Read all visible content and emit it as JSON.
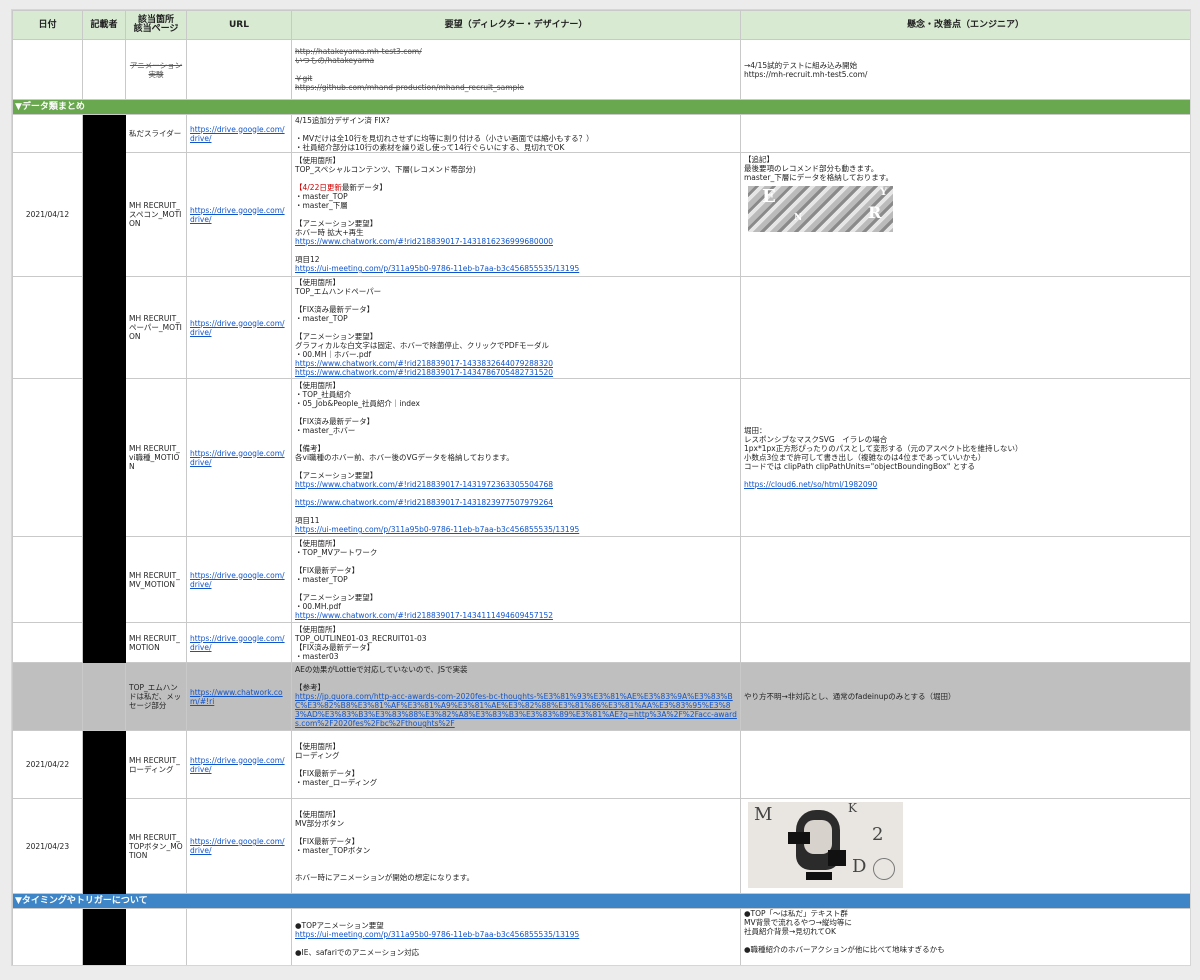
{
  "headers": {
    "date": "日付",
    "author": "記載者",
    "page": "該当箇所\n該当ページ",
    "url": "URL",
    "request": "要望（ディレクター・デザイナー）",
    "concerns": "懸念・改善点（エンジニア）"
  },
  "rows": [
    {
      "date": "",
      "page": "アニメーション実験",
      "url": "",
      "request": "http://hatakeyama.mh-test3.com/\nいつもの/hatakeyama\n\n￥git\nhttps://github.com/mhand-production/mhand_recruit_sample",
      "concerns": "→4/15試的テストに組み込み開始\nhttps://mh-recruit.mh-test5.com/"
    }
  ],
  "sections": {
    "data": "▼データ類まとめ",
    "timing": "▼タイミングやトリガーについて"
  },
  "data_rows": [
    {
      "date": "",
      "page": "私だスライダー",
      "url": "https://drive.google.com/drive/",
      "request": "4/15追加分デザイン済 FIX?\n\n・MVだけは全10行を見切れさせずに均等に割り付ける（小さい画面では縮小もする？）\n・社員紹介部分は10行の素材を繰り返し使って14行ぐらいにする、見切れでOK",
      "concerns": ""
    },
    {
      "date": "2021/04/12",
      "page": "MH RECRUIT_スペコン_MOTION",
      "url": "https://drive.google.com/drive/",
      "request_parts": {
        "l1": "【使用箇所】",
        "l2": "TOP_スペシャルコンテンツ、下層(レコメンド帯部分)",
        "red": "【4/22日更新",
        "l3": "最新データ】",
        "l4": "・master_TOP\n・master_下層\n\n【アニメーション要望】\nホバー時 拡大+再生",
        "link1": "https://www.chatwork.com/#!rid218839017-1431816236999680000",
        "l5": "\n項目12",
        "link2": "https://ui-meeting.com/p/311a95b0-9786-11eb-b7aa-b3c456855535/13195"
      },
      "concerns": "【追記】\n最後要項のレコメンド部分も動きます。\nmaster_下層にデータを格納しております。"
    },
    {
      "date": "",
      "page": "MH RECRUIT_ペーパー_MOTION",
      "url": "https://drive.google.com/drive/",
      "request": "【使用箇所】\nTOP_エムハンドペーパー\n\n【FIX済み最新データ】\n・master_TOP\n\n【アニメーション要望】\nグラフィカルな白文字は固定、ホバーで除菌停止、クリックでPDFモーダル\n・00.MH｜ホバー.pdf",
      "links": [
        "https://www.chatwork.com/#!rid218839017-1433832644079288320",
        "https://www.chatwork.com/#!rid218839017-1434786705482731520"
      ],
      "concerns": ""
    },
    {
      "date": "",
      "page": "MH RECRUIT_vi職種_MOTION",
      "url": "https://drive.google.com/drive/",
      "request": "【使用箇所】\n・TOP_社員紹介\n・05_Job&People_社員紹介｜index\n\n【FIX済み最新データ】\n・master_ホバー\n\n【備考】\n各vi職種のホバー前、ホバー後のVGデータを格納しております。\n\n【アニメーション要望】",
      "links": [
        "https://www.chatwork.com/#!rid218839017-1431972363305504768",
        "https://www.chatwork.com/#!rid218839017-1431823977507979264"
      ],
      "request_tail": "項目11",
      "link_tail": "https://ui-meeting.com/p/311a95b0-9786-11eb-b7aa-b3c456855535/13195",
      "concerns": "堀田：\nレスポンシブなマスクSVG　イラレの場合\n1px*1px正方形ぴったりのパスとして変形する（元のアスペクト比を維持しない）\n小数点3位まで許可して書き出し（複雑なのは4位まであっていいかも）\nコードでは clipPath clipPathUnits=\"objectBoundingBox\" とする",
      "concerns_link": "https://cloud6.net/so/html/1982090"
    },
    {
      "date": "",
      "page": "MH RECRUIT_MV_MOTION",
      "url": "https://drive.google.com/drive/",
      "request": "【使用箇所】\n・TOP_MVアートワーク\n\n【FIX最新データ】\n・master_TOP\n\n【アニメーション要望】\n・00.MH.pdf",
      "links": [
        "https://www.chatwork.com/#!rid218839017-1434111494609457152"
      ],
      "concerns": ""
    },
    {
      "date": "",
      "page": "MH RECRUIT_MOTION",
      "url": "https://drive.google.com/drive/",
      "request": "【使用箇所】\nTOP_OUTLINE01-03_RECRUIT01-03\n【FIX済み最新データ】\n・master03",
      "concerns": ""
    },
    {
      "date": "",
      "page": "TOP_エムハンドは私だ、メッセージ部分",
      "url": "https://www.chatwork.com/#!ri",
      "request": "AEの効果がLottieで対応していないので、JSで実装\n\n【参考】",
      "links": [
        "https://jp.quora.com/http-acc-awards-com-2020fes-bc-thoughts-%E3%81%93%E3%81%AE%E3%83%9A%E3%83%BC%E3%82%B8%E3%81%AF%E3%81%A9%E3%81%AE%E3%82%88%E3%81%86%E3%81%AA%E3%83%95%E3%83%AD%E3%83%B3%E3%83%88%E3%82%A8%E3%83%B3%E3%83%89%E3%81%AE?q=http%3A%2F%2Facc-awards.com%2F2020fes%2Fbc%2Fthoughts%2F"
      ],
      "concerns": "やり方不明→非対応とし、通常のfadeinupのみとする（堀田）"
    },
    {
      "date": "2021/04/22",
      "page": "MH RECRUIT_ローディング",
      "url": "https://drive.google.com/drive/",
      "request": "【使用箇所】\nローディング\n\n【FIX最新データ】\n・master_ローディング",
      "concerns": ""
    },
    {
      "date": "2021/04/23",
      "page": "MH RECRUIT_TOPボタン_MOTION",
      "url": "https://drive.google.com/drive/",
      "request": "【使用箇所】\nMV部分ボタン\n\n【FIX最新データ】\n・master_TOPボタン\n\n\nホバー時にアニメーションが開始の想定になります。",
      "concerns": ""
    }
  ],
  "timing_row": {
    "request": "●TOPアニメーション要望",
    "link": "https://ui-meeting.com/p/311a95b0-9786-11eb-b7aa-b3c456855535/13195",
    "request_tail": "●IE、safariでのアニメーション対応",
    "concerns": "●TOP「～は私だ」テキスト群\nMV背景で流れるやつ→縦均等に\n社員紹介背景→見切れてOK\n\n●職種紹介のホバーアクションが他に比べて地味すぎるかも"
  },
  "images": {
    "thumb1_letters": [
      "E",
      "N",
      "R",
      "Y"
    ],
    "thumb2_letters": [
      "M",
      "2",
      "D",
      "K"
    ]
  }
}
